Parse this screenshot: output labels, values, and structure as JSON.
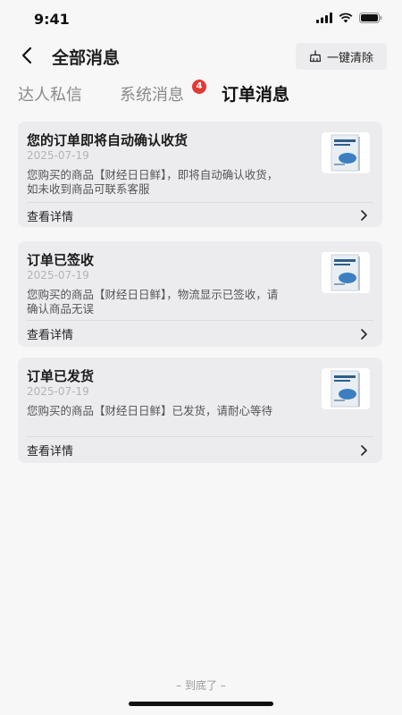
{
  "status_bar": {
    "time": "9:41"
  },
  "header": {
    "title": "全部消息",
    "clear_label": "一键清除"
  },
  "tabs": [
    {
      "label": "达人私信"
    },
    {
      "label": "系统消息",
      "badge": "4"
    },
    {
      "label": "订单消息",
      "active": true
    }
  ],
  "cards": [
    {
      "title": "您的订单即将自动确认收货",
      "date": "2025-07-19",
      "body": "您购买的商品【财经日日鲜】，即将自动确认收货，如未收到商品可联系客服",
      "action": "查看详情"
    },
    {
      "title": "订单已签收",
      "date": "2025-07-19",
      "body": "您购买的商品【财经日日鲜】，物流显示已签收，请确认商品无误",
      "action": "查看详情"
    },
    {
      "title": "订单已发货",
      "date": "2025-07-19",
      "body": "您购买的商品【财经日日鲜】已发货，请耐心等待",
      "action": "查看详情"
    }
  ],
  "footer": {
    "end_text": "– 到底了 –"
  },
  "colors": {
    "badge": "#e53935",
    "card_bg": "#ececef",
    "page_bg": "#f7f7f8"
  }
}
